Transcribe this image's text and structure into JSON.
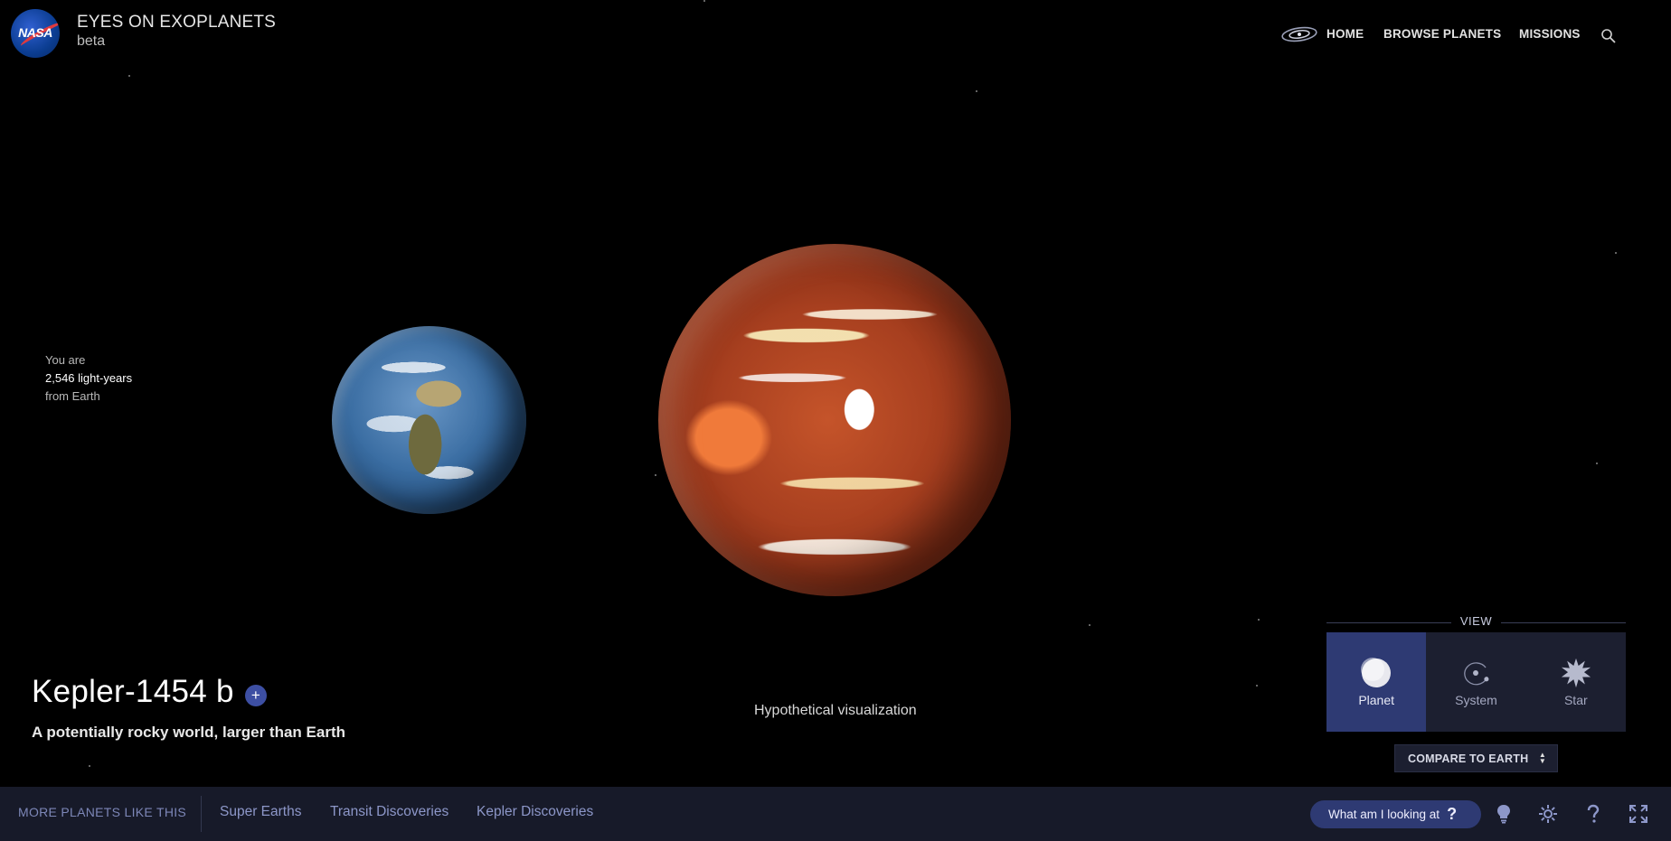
{
  "header": {
    "logo_text": "NASA",
    "title": "EYES ON EXOPLANETS",
    "subtitle": "beta",
    "nav": {
      "galaxy_icon": "galaxy-icon",
      "home": "HOME",
      "browse": "BROWSE PLANETS",
      "missions": "MISSIONS",
      "search_icon": "search-icon"
    }
  },
  "distance": {
    "line1": "You are",
    "line2": "2,546 light-years",
    "line3": "from Earth"
  },
  "planet": {
    "name": "Kepler-1454 b",
    "add_symbol": "+",
    "tagline": "A potentially rocky world, larger than Earth",
    "visualization_note": "Hypothetical visualization"
  },
  "view_panel": {
    "label": "VIEW",
    "options": [
      {
        "label": "Planet",
        "icon": "planet-icon",
        "active": true
      },
      {
        "label": "System",
        "icon": "system-icon",
        "active": false
      },
      {
        "label": "Star",
        "icon": "star-icon",
        "active": false
      }
    ],
    "compare_label": "COMPARE TO EARTH"
  },
  "bottom_bar": {
    "more_label": "MORE PLANETS LIKE THIS",
    "categories": [
      "Super Earths",
      "Transit Discoveries",
      "Kepler Discoveries"
    ],
    "what_label": "What am I looking at",
    "what_symbol": "?",
    "icons": [
      "lightbulb-icon",
      "gear-icon",
      "help-icon",
      "fullscreen-icon"
    ]
  },
  "colors": {
    "accent": "#2e3a73",
    "link": "#8d97c9",
    "panel": "#1c1f30",
    "bar": "#171a29"
  }
}
